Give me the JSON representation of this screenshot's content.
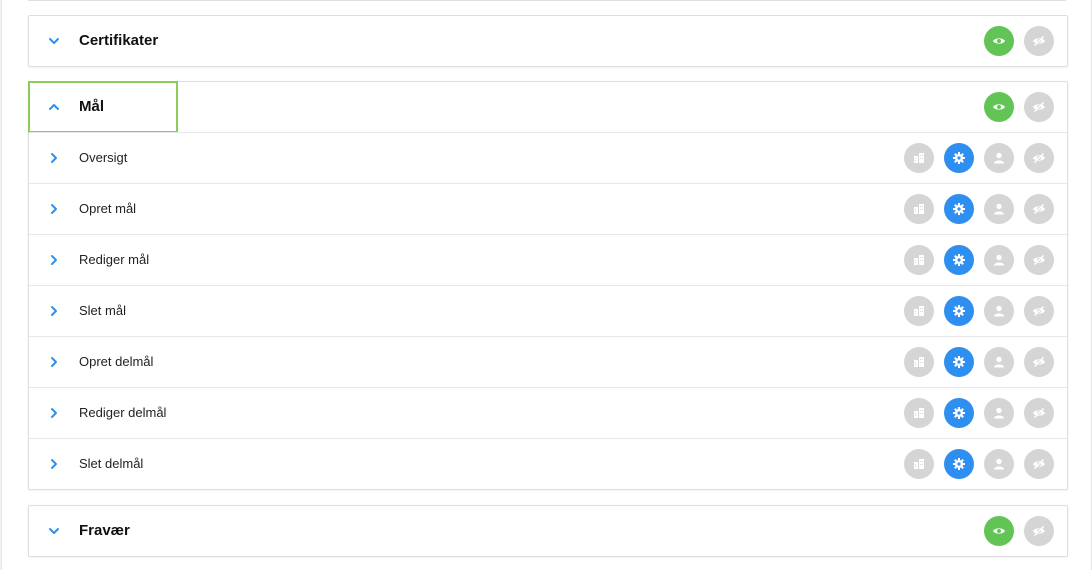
{
  "sections": [
    {
      "title": "Certifikater",
      "expanded": false
    },
    {
      "title": "Mål",
      "expanded": true,
      "items": [
        {
          "label": "Oversigt"
        },
        {
          "label": "Opret mål"
        },
        {
          "label": "Rediger mål"
        },
        {
          "label": "Slet mål"
        },
        {
          "label": "Opret delmål"
        },
        {
          "label": "Rediger delmål"
        },
        {
          "label": "Slet delmål"
        }
      ]
    },
    {
      "title": "Fravær",
      "expanded": false
    }
  ],
  "colors": {
    "accent_blue": "#2f8ff0",
    "visible_green": "#62c454",
    "inactive_gray": "#d5d5d5",
    "focus_outline": "#8ccc5c"
  },
  "icons": {
    "collapsed": "chevron-down-icon",
    "expanded": "chevron-up-icon",
    "row_expand": "chevron-right-icon",
    "visible": "eye-icon",
    "hidden": "eye-slash-icon",
    "org": "building-icon",
    "settings": "gear-icon",
    "user": "user-icon"
  }
}
